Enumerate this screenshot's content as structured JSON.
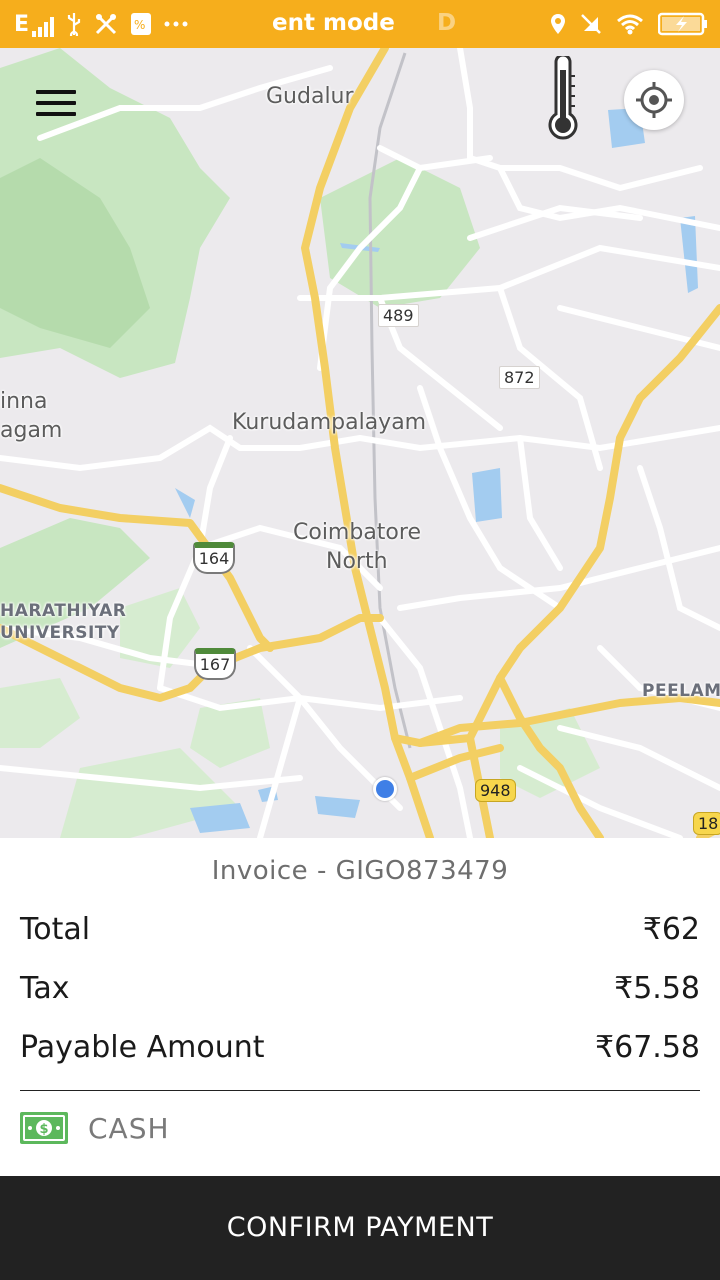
{
  "status_bar": {
    "network_type": "E",
    "ticker_text": "ent mode",
    "ticker_fade": "D",
    "icons": [
      "signal-icon",
      "usb-icon",
      "tools-icon",
      "data-saver-icon",
      "more-dots-icon",
      "location-pin-icon",
      "muted-notification-icon",
      "wifi-icon",
      "battery-charging-icon"
    ]
  },
  "map": {
    "labels": {
      "gudalur": "Gudalur",
      "chinna_line1": "inna",
      "chinna_line2": "agam",
      "kurudampalayam": "Kurudampalayam",
      "coimbatore_line1": "Coimbatore",
      "coimbatore_line2": "North",
      "bharathiyar_line1": "HARATHIYAR",
      "bharathiyar_line2": "UNIVERSITY",
      "peelamedu": "PEELAME"
    },
    "road_numbers": {
      "r489": "489",
      "r872": "872",
      "r164": "164",
      "r167": "167",
      "r948": "948",
      "r18": "18"
    },
    "controls": {
      "menu": "hamburger-menu-icon",
      "thermometer": "thermometer-icon",
      "locate": "locate-me-icon"
    },
    "colors": {
      "background": "#eceaed",
      "park": "#c8e6c1",
      "water": "#a3ccf0",
      "road": "#ffffff",
      "highway": "#fcd86e"
    }
  },
  "invoice": {
    "title": "Invoice - GIGO873479",
    "rows": [
      {
        "label": "Total",
        "value": "₹62"
      },
      {
        "label": "Tax",
        "value": "₹5.58"
      },
      {
        "label": "Payable Amount",
        "value": "₹67.58"
      }
    ],
    "payment_method": "CASH",
    "payment_icon": "cash-note-icon"
  },
  "actions": {
    "confirm_label": "CONFIRM PAYMENT"
  },
  "theme": {
    "status_bar": "#f6ae1c",
    "confirm_bg": "#222222",
    "cash_green": "#5cb85c"
  }
}
